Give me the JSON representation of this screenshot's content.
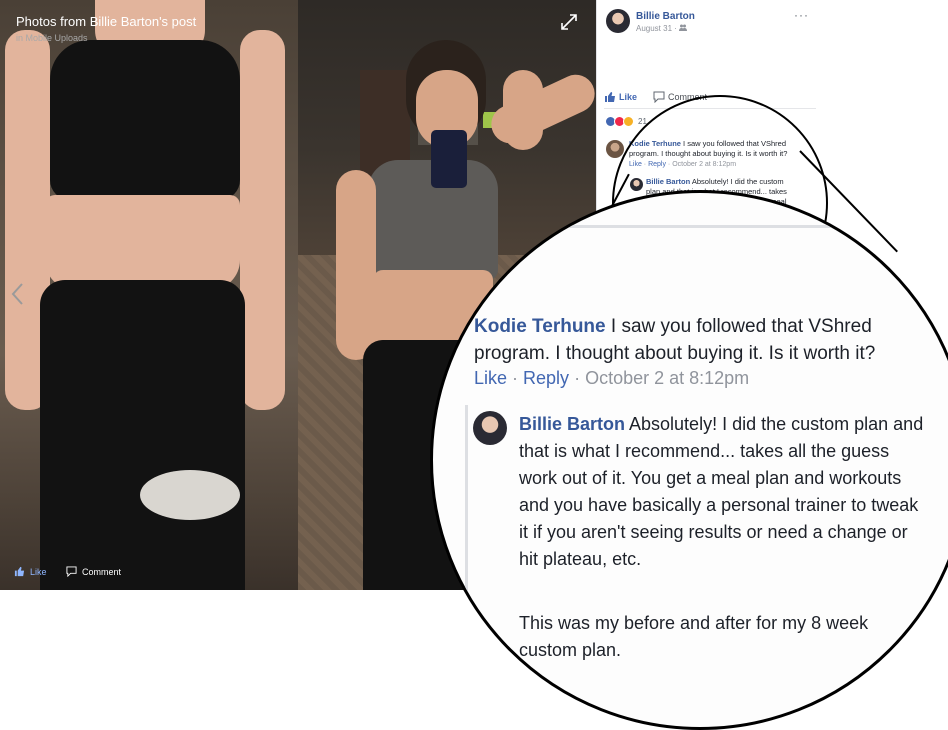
{
  "viewer": {
    "title": "Photos from Billie Barton's post",
    "subtitle": "in Mobile Uploads",
    "like_label": "Like",
    "comment_label": "Comment"
  },
  "post": {
    "author": "Billie Barton",
    "date": "August 31 · ",
    "more": "···",
    "like_label": "Like",
    "comment_label": "Comment",
    "reaction_count": "21"
  },
  "comment": {
    "author": "Kodie Terhune",
    "text": " I saw you followed that VShred program. I thought about buying it. Is it worth it?",
    "like": "Like",
    "reply": "Reply",
    "date": "October 2 at 8:12pm",
    "sep": " · "
  },
  "reply": {
    "author": "Billie Barton",
    "text": " Absolutely! I did the custom plan and that is what I recommend... takes all the guess work out of it. You get a meal plan and workouts and you have basically a personal trainer to tweak it if you aren't seeing results or need a change or hit plateau, etc.",
    "text2": "This was my before and after for my 8 week custom plan."
  },
  "colors": {
    "facebook_blue": "#365899",
    "like_blue": "#4267b2",
    "muted_text": "#90949c"
  }
}
